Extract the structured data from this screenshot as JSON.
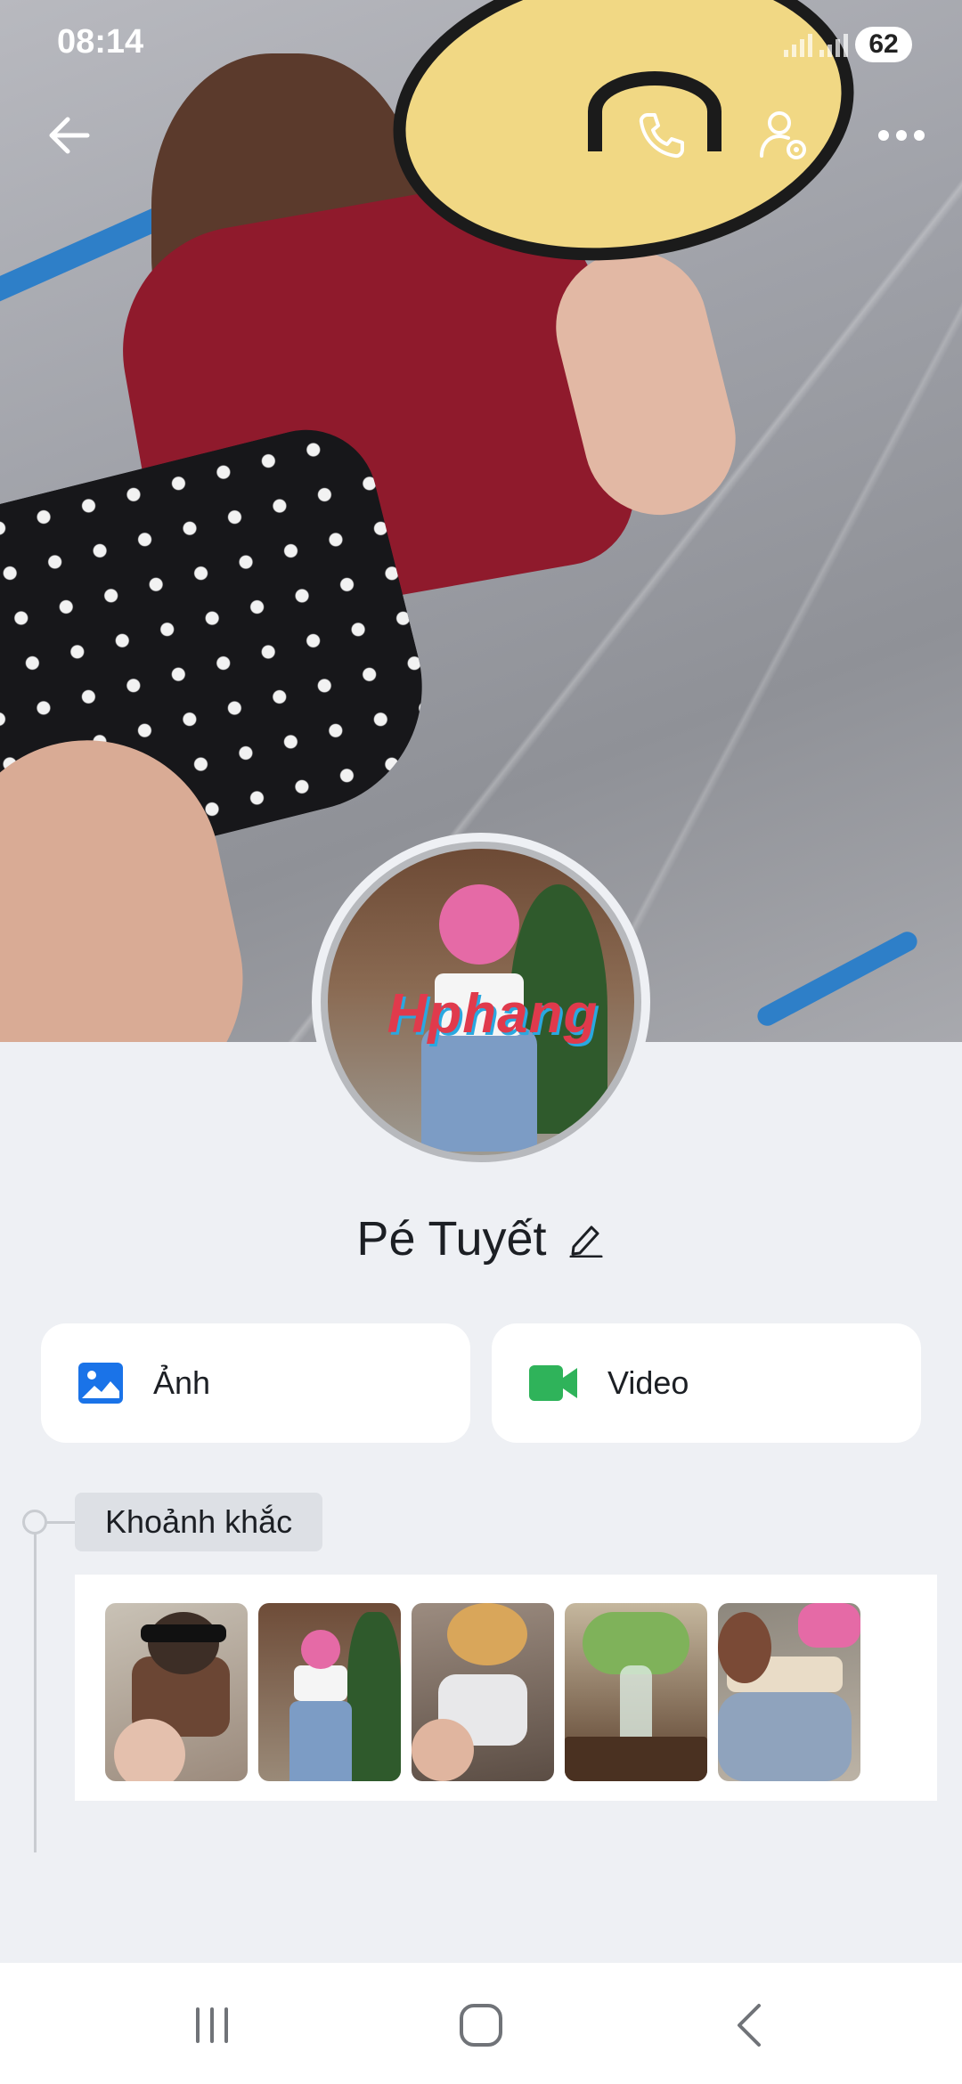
{
  "status_bar": {
    "time": "08:14",
    "battery": "62"
  },
  "profile": {
    "name": "Pé Tuyết",
    "avatar_watermark": "Hphang"
  },
  "media": [
    {
      "label": "Ảnh",
      "icon": "image-icon",
      "color": "#1a73e8"
    },
    {
      "label": "Video",
      "icon": "video-icon",
      "color": "#2fb35a"
    }
  ],
  "moments": {
    "title": "Khoảnh khắc",
    "thumbnails": [
      {
        "name": "moment-photo-1"
      },
      {
        "name": "moment-photo-2"
      },
      {
        "name": "moment-photo-3"
      },
      {
        "name": "moment-photo-4"
      },
      {
        "name": "moment-photo-5"
      }
    ]
  },
  "icons": {
    "back": "back-arrow-icon",
    "call": "phone-icon",
    "settings": "profile-settings-icon",
    "more": "more-icon",
    "edit": "edit-pencil-icon"
  }
}
